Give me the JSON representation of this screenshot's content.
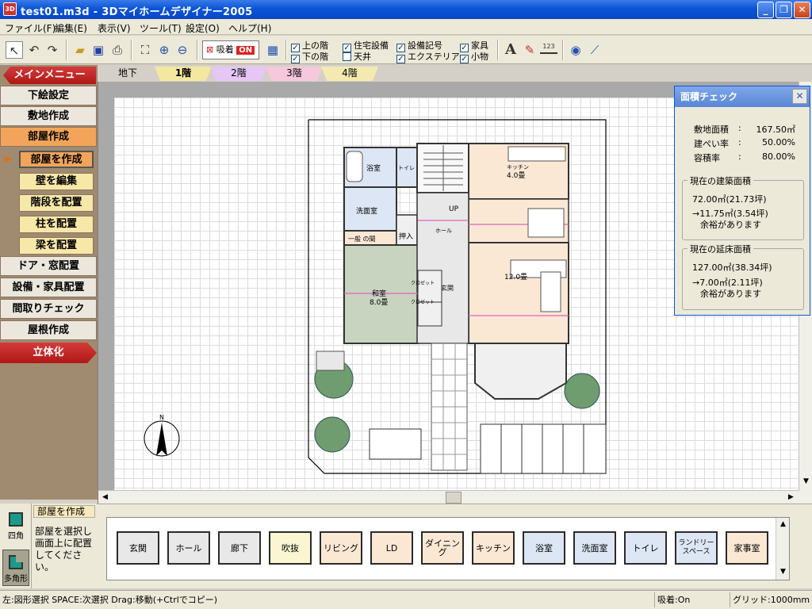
{
  "window": {
    "title": "test01.m3d - 3Dマイホームデザイナー2005",
    "app_icon": "3D",
    "minimize": "_",
    "maximize": "❐",
    "close": "✕"
  },
  "menu": [
    "ファイル(F)",
    "編集(E)",
    "表示(V)",
    "ツール(T)",
    "設定(O)",
    "ヘルプ(H)"
  ],
  "toolbar": {
    "snap_label": "吸着",
    "snap_state": "ON",
    "checkboxes": [
      {
        "label": "上の階",
        "checked": true
      },
      {
        "label": "下の階",
        "checked": true
      },
      {
        "label": "住宅設備",
        "checked": true
      },
      {
        "label": "天井",
        "checked": false
      },
      {
        "label": "設備記号",
        "checked": true
      },
      {
        "label": "エクステリア",
        "checked": true
      },
      {
        "label": "家具",
        "checked": true
      },
      {
        "label": "小物",
        "checked": true
      }
    ],
    "text_tool": "A",
    "dimension_tool": "123"
  },
  "left_menu": {
    "main_menu": "メインメニュー",
    "items": [
      "下絵設定",
      "敷地作成",
      "部屋作成"
    ],
    "sub_items": [
      "部屋を作成",
      "壁を編集",
      "階段を配置",
      "柱を配置",
      "梁を配置"
    ],
    "items2": [
      "ドア・窓配置",
      "設備・家具配置",
      "間取りチェック",
      "屋根作成"
    ],
    "threed": "立体化"
  },
  "floor_tabs": [
    "地下",
    "1階",
    "2階",
    "3階",
    "4階"
  ],
  "floor_colors": [
    "#d4d0c8",
    "#f4e7a0",
    "#e6c6f4",
    "#f6c8dc",
    "#f4eab0"
  ],
  "plan_labels": {
    "bath": "浴室",
    "toilet": "トイレ",
    "washroom": "洗面室",
    "closet": "一般 の間",
    "oshiire": "押入",
    "kitchen": "キッチン",
    "kitchen_size": "4.0畳",
    "up": "UP",
    "hall": "ホール",
    "living": "12.0畳",
    "japanese": "和室",
    "japanese_size": "8.0畳",
    "cloak1": "クロゼット",
    "cloak2": "クロゼット",
    "entrance": "玄関",
    "north": "N"
  },
  "area_check": {
    "title": "面積チェック",
    "close": "✕",
    "site_label": "敷地面積",
    "site_value": "167.50㎡",
    "coverage_label": "建ぺい率",
    "coverage_value": "50.00%",
    "far_label": "容積率",
    "far_value": "80.00%",
    "building_group": "現在の建築面積",
    "building_value": "72.00㎡(21.73坪)",
    "building_remain": "→11.75㎡(3.54坪)",
    "building_note": "余裕があります",
    "floor_group": "現在の延床面積",
    "floor_value": "127.00㎡(38.34坪)",
    "floor_remain": "→7.00㎡(2.11坪)",
    "floor_note": "余裕があります",
    "separator": ":"
  },
  "bottom": {
    "shape1": "四角",
    "shape2": "多角形",
    "mode_title": "部屋を作成",
    "description": "部屋を選択し画面上に配置してください。"
  },
  "room_palette": [
    {
      "label": "玄関",
      "color": "#e8e8e8"
    },
    {
      "label": "ホール",
      "color": "#e8e8e8"
    },
    {
      "label": "廊下",
      "color": "#e8e8e8"
    },
    {
      "label": "吹抜",
      "color": "#fbf6d2"
    },
    {
      "label": "リビング",
      "color": "#fbe8d4"
    },
    {
      "label": "LD",
      "color": "#fbe8d4"
    },
    {
      "label": "ダイニング",
      "color": "#fbe8d4"
    },
    {
      "label": "キッチン",
      "color": "#fbe8d4"
    },
    {
      "label": "浴室",
      "color": "#dde6f5"
    },
    {
      "label": "洗面室",
      "color": "#dde6f5"
    },
    {
      "label": "トイレ",
      "color": "#dde6f5"
    },
    {
      "label": "ランドリースペース",
      "color": "#dde6f5"
    },
    {
      "label": "家事室",
      "color": "#fbe8d4"
    }
  ],
  "status": {
    "help": "左:図形選択 SPACE:次選択 Drag:移動(+Ctrlでコピー)",
    "snap": "吸着:On",
    "grid": "グリッド:1000mm"
  }
}
